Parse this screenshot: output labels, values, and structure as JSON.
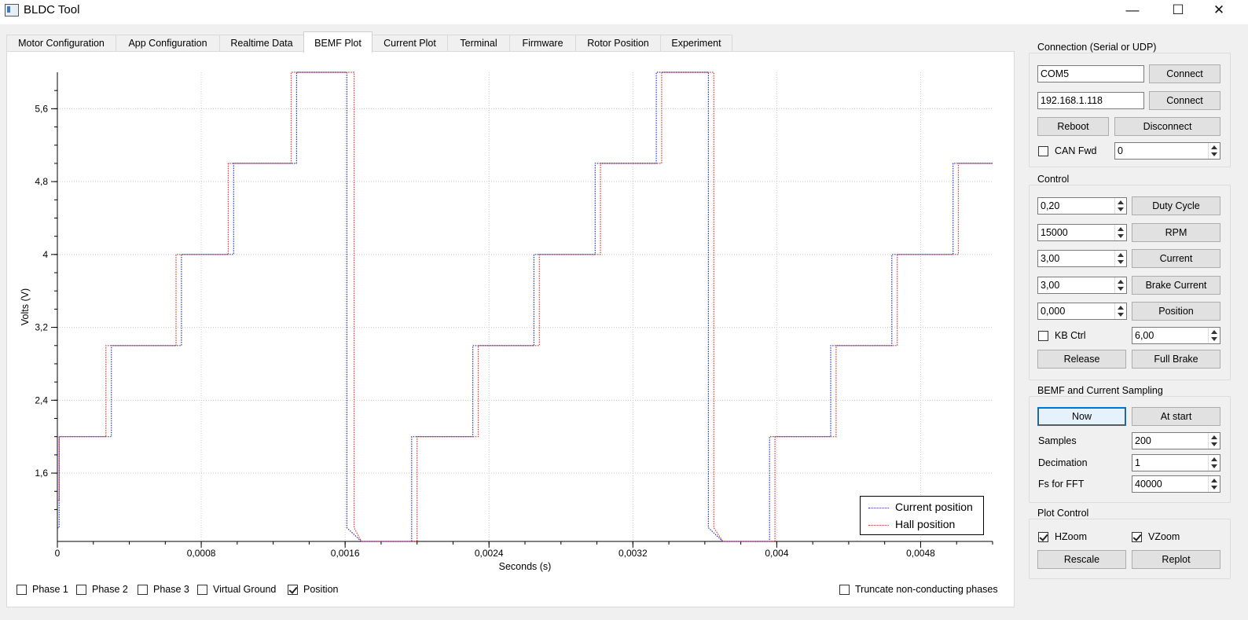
{
  "window": {
    "title": "BLDC Tool",
    "minimize": "—",
    "maximize": "☐",
    "close": "✕"
  },
  "tabs": [
    "Motor Configuration",
    "App Configuration",
    "Realtime Data",
    "BEMF Plot",
    "Current Plot",
    "Terminal",
    "Firmware",
    "Rotor Position",
    "Experiment"
  ],
  "active_tab": "BEMF Plot",
  "chart_data": {
    "type": "line",
    "xlabel": "Seconds (s)",
    "ylabel": "Volts (V)",
    "xlim": [
      0,
      0.0052
    ],
    "ylim": [
      0.85,
      6.0
    ],
    "xticks": [
      0,
      0.0008,
      0.0016,
      0.0024,
      0.0032,
      0.004,
      0.0048
    ],
    "xtick_labels": [
      "0",
      "0,0008",
      "0,0016",
      "0,0024",
      "0,0032",
      "0,004",
      "0,0048"
    ],
    "yticks": [
      1.6,
      2.4,
      3.2,
      4,
      4.8,
      5.6
    ],
    "ytick_labels": [
      "1,6",
      "2,4",
      "3,2",
      "4",
      "4,8",
      "5,6"
    ],
    "grid": true,
    "legend_position": "bottom-right",
    "series": [
      {
        "name": "Current position",
        "color": "#2233cc",
        "x": [
          0,
          1e-05,
          1e-05,
          0.0003,
          0.0003,
          0.00069,
          0.00069,
          0.00098,
          0.00098,
          0.00133,
          0.00133,
          0.00161,
          0.00161,
          0.00169,
          0.00197,
          0.00197,
          0.00231,
          0.00231,
          0.00265,
          0.00265,
          0.00299,
          0.00299,
          0.00333,
          0.00333,
          0.00362,
          0.00362,
          0.0037,
          0.00396,
          0.00396,
          0.0043,
          0.0043,
          0.00464,
          0.00464,
          0.00498,
          0.00498,
          0.0052
        ],
        "y": [
          1.0,
          1.0,
          2.0,
          2.0,
          3.0,
          3.0,
          4.0,
          4.0,
          5.0,
          5.0,
          6.0,
          6.0,
          1.0,
          0.85,
          0.85,
          2.0,
          2.0,
          3.0,
          3.0,
          4.0,
          4.0,
          5.0,
          5.0,
          6.0,
          6.0,
          1.0,
          0.85,
          0.85,
          2.0,
          2.0,
          3.0,
          3.0,
          4.0,
          4.0,
          5.0,
          5.0
        ]
      },
      {
        "name": "Hall position",
        "color": "#dd3333",
        "x": [
          0,
          1e-05,
          1e-05,
          0.00027,
          0.00027,
          0.00066,
          0.00066,
          0.00095,
          0.00095,
          0.0013,
          0.0013,
          0.00165,
          0.00165,
          0.00169,
          0.002,
          0.002,
          0.00234,
          0.00234,
          0.00268,
          0.00268,
          0.00302,
          0.00302,
          0.00336,
          0.00336,
          0.00365,
          0.00365,
          0.0037,
          0.00399,
          0.00399,
          0.00433,
          0.00433,
          0.00467,
          0.00467,
          0.00501,
          0.00501,
          0.0052
        ],
        "y": [
          1.3,
          1.3,
          2.0,
          2.0,
          3.0,
          3.0,
          4.0,
          4.0,
          5.0,
          5.0,
          6.0,
          6.0,
          1.0,
          0.85,
          0.85,
          2.0,
          2.0,
          3.0,
          3.0,
          4.0,
          4.0,
          5.0,
          5.0,
          6.0,
          6.0,
          1.0,
          0.85,
          0.85,
          2.0,
          2.0,
          3.0,
          3.0,
          4.0,
          4.0,
          5.0,
          5.0
        ]
      }
    ]
  },
  "plot_options": {
    "phase1": {
      "label": "Phase 1",
      "checked": false
    },
    "phase2": {
      "label": "Phase 2",
      "checked": false
    },
    "phase3": {
      "label": "Phase 3",
      "checked": false
    },
    "virtual_ground": {
      "label": "Virtual Ground",
      "checked": false
    },
    "position": {
      "label": "Position",
      "checked": true
    },
    "truncate": {
      "label": "Truncate non-conducting phases",
      "checked": false
    }
  },
  "connection": {
    "title": "Connection (Serial or UDP)",
    "serial_port": "COM5",
    "connect_serial_label": "Connect",
    "udp_address": "192.168.1.118",
    "connect_udp_label": "Connect",
    "reboot_label": "Reboot",
    "disconnect_label": "Disconnect",
    "can_fwd_label": "CAN Fwd",
    "can_fwd_checked": false,
    "can_fwd_id": "0"
  },
  "control": {
    "title": "Control",
    "duty_value": "0,20",
    "duty_label": "Duty Cycle",
    "rpm_value": "15000",
    "rpm_label": "RPM",
    "current_value": "3,00",
    "current_label": "Current",
    "brake_value": "3,00",
    "brake_label": "Brake Current",
    "position_value": "0,000",
    "position_label": "Position",
    "kb_ctrl_label": "KB Ctrl",
    "kb_ctrl_checked": false,
    "kb_value": "6,00",
    "release_label": "Release",
    "full_brake_label": "Full Brake"
  },
  "sampling": {
    "title": "BEMF and Current Sampling",
    "now_label": "Now",
    "at_start_label": "At start",
    "samples_label": "Samples",
    "samples_value": "200",
    "decimation_label": "Decimation",
    "decimation_value": "1",
    "fs_label": "Fs for FFT",
    "fs_value": "40000"
  },
  "plot_control": {
    "title": "Plot Control",
    "hzoom_label": "HZoom",
    "hzoom_checked": true,
    "vzoom_label": "VZoom",
    "vzoom_checked": true,
    "rescale_label": "Rescale",
    "replot_label": "Replot"
  }
}
